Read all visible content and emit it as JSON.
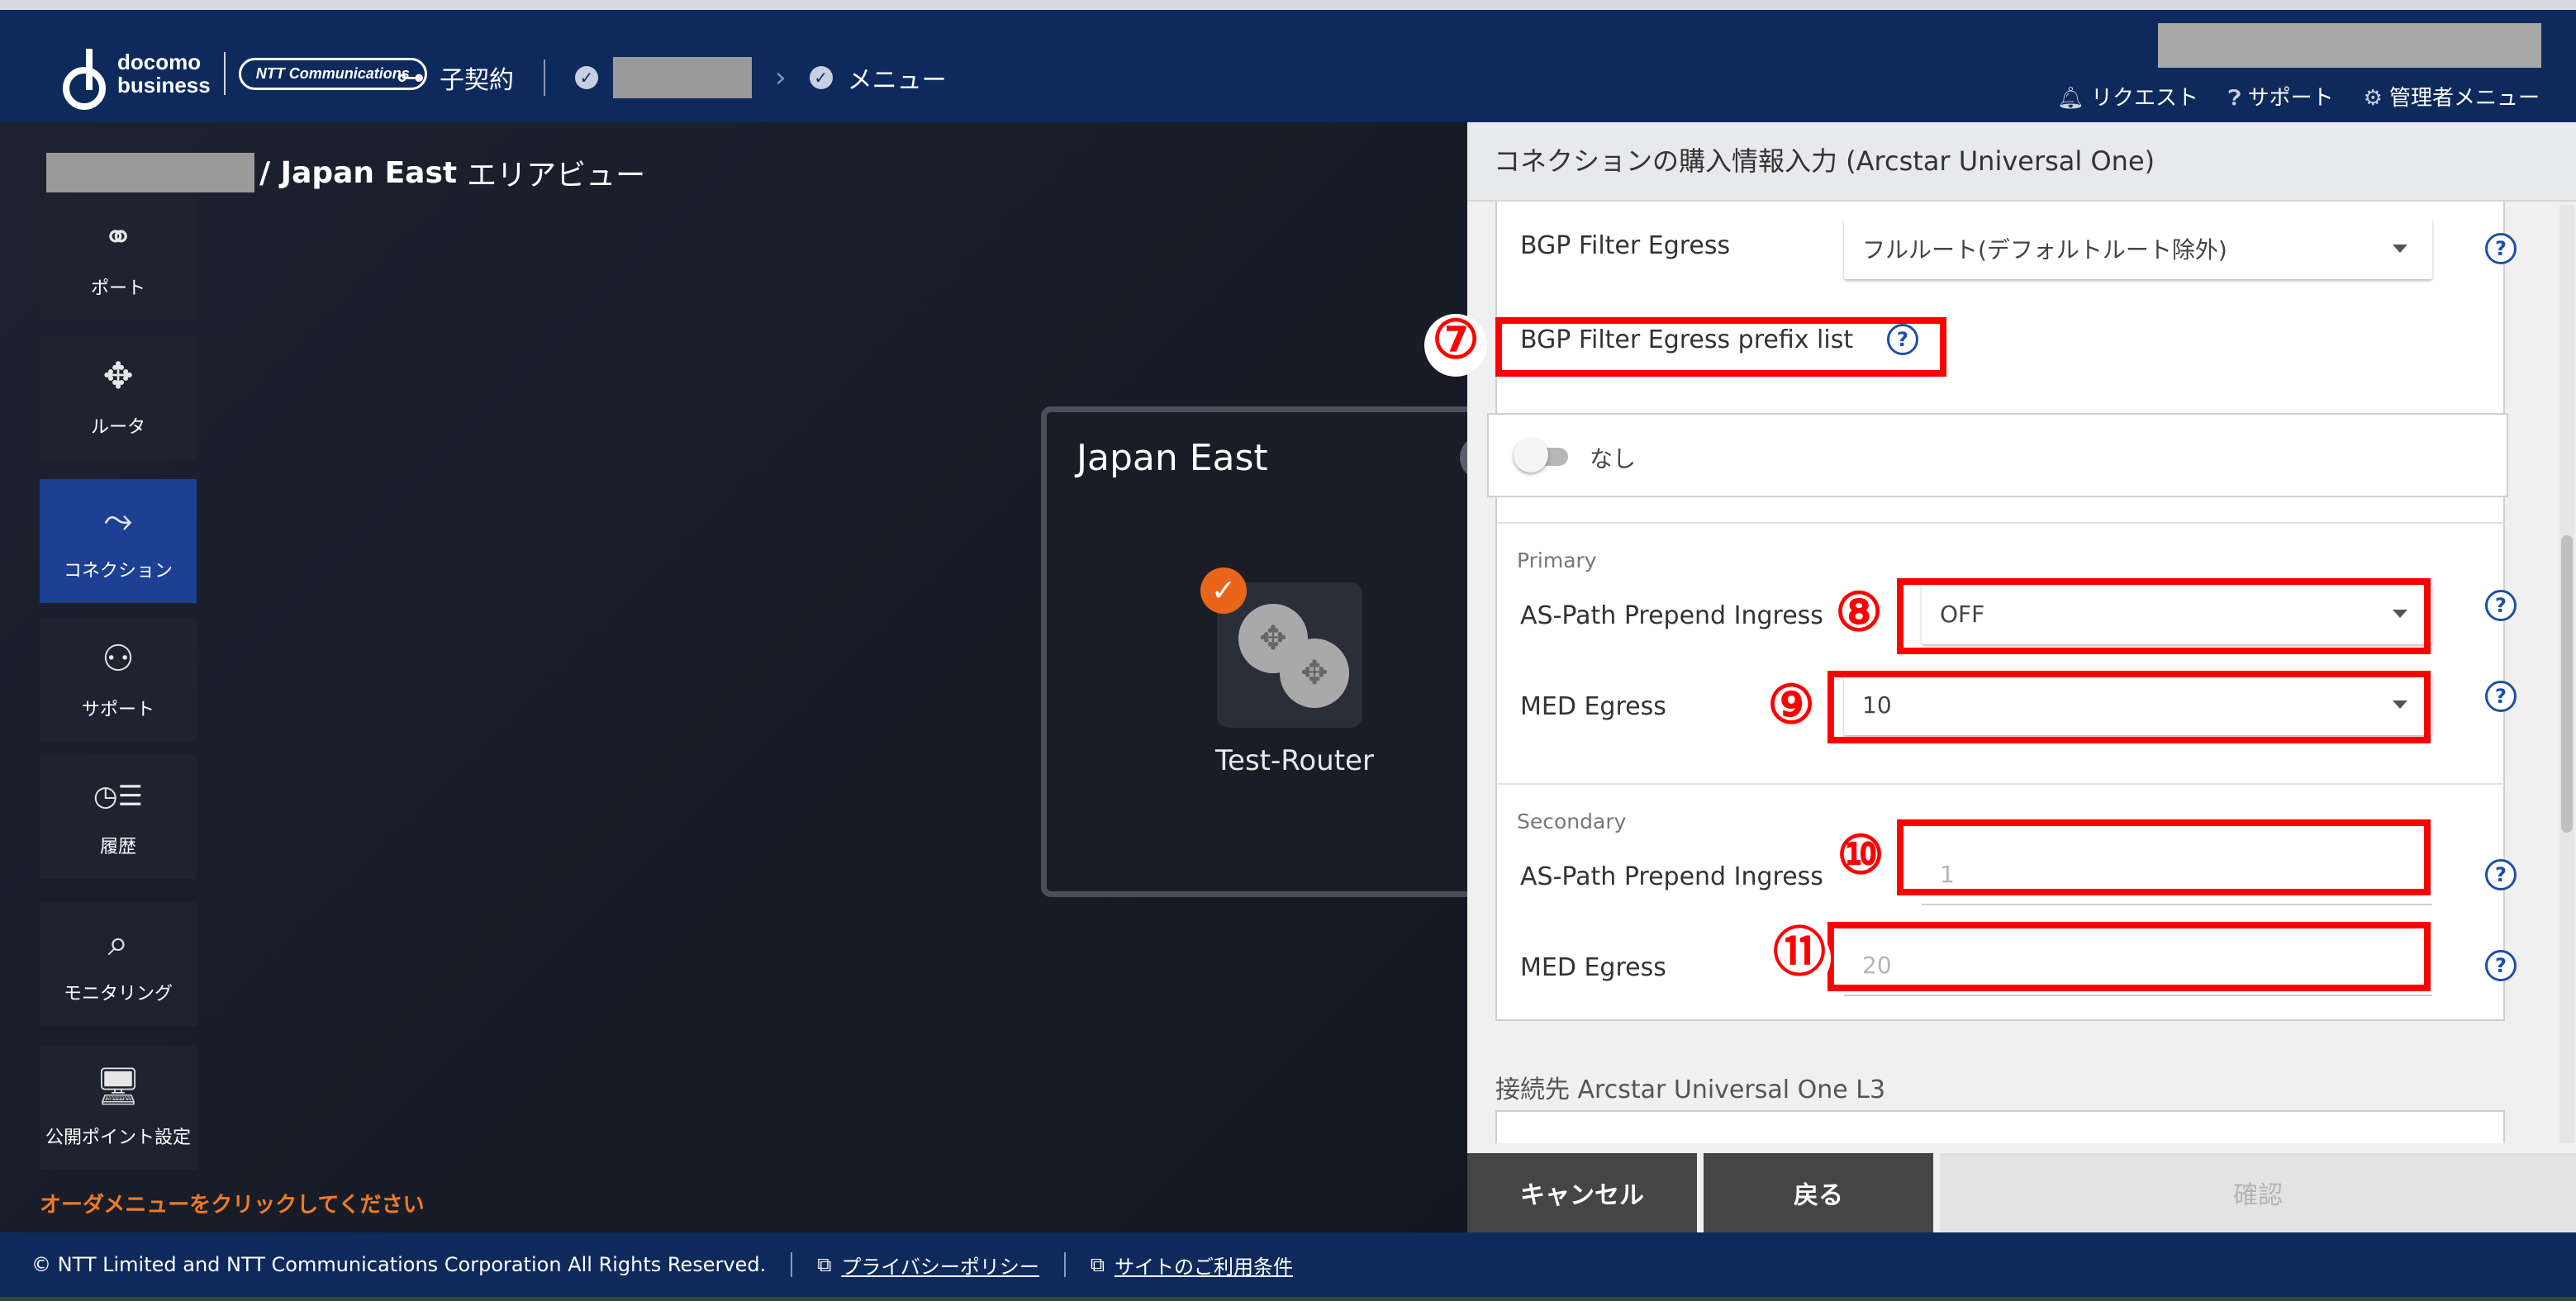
{
  "header": {
    "logo_line1": "docomo",
    "logo_line2": "business",
    "ntt_logo": "NTT Communications",
    "nav_contract": "子契約",
    "nav_menu": "メニュー",
    "menu_request": "リクエスト",
    "menu_support": "サポート",
    "menu_admin": "管理者メニュー"
  },
  "area": {
    "title_suffix": "/ Japan East",
    "title_view": "エリアビュー",
    "box_title": "Japan East",
    "router_label": "Test-Router"
  },
  "sidebar": {
    "items": [
      {
        "label": "ポート",
        "icon": "port-icon"
      },
      {
        "label": "ルータ",
        "icon": "router-icon"
      },
      {
        "label": "コネクション",
        "icon": "connection-icon"
      },
      {
        "label": "サポート",
        "icon": "support-user-icon"
      },
      {
        "label": "履歴",
        "icon": "history-icon"
      },
      {
        "label": "モニタリング",
        "icon": "monitoring-icon"
      },
      {
        "label": "公開ポイント設定",
        "icon": "public-point-icon"
      }
    ],
    "active": "コネクション"
  },
  "order_message": "オーダメニューをクリックしてください",
  "panel": {
    "title": "コネクションの購入情報入力 (Arcstar Universal One)",
    "bgp_filter_egress_label": "BGP Filter Egress",
    "bgp_filter_egress_value": "フルルート(デフォルトルート除外)",
    "bgp_prefix_label": "BGP Filter Egress prefix list",
    "toggle_label": "なし",
    "primary_label": "Primary",
    "primary_aspath_label": "AS-Path Prepend Ingress",
    "primary_aspath_value": "OFF",
    "primary_med_label": "MED Egress",
    "primary_med_value": "10",
    "secondary_label": "Secondary",
    "secondary_aspath_label": "AS-Path Prepend Ingress",
    "secondary_aspath_value": "1",
    "secondary_med_label": "MED Egress",
    "secondary_med_value": "20",
    "connection_target_label": "接続先 Arcstar Universal One L3",
    "help_glyph": "?"
  },
  "annotations": {
    "n7": "⑦",
    "n8": "⑧",
    "n9": "⑨",
    "n10": "⑩",
    "n11": "⑪",
    "color": "#ff0000"
  },
  "buttons": {
    "cancel": "キャンセル",
    "back": "戻る",
    "confirm": "確認"
  },
  "footer": {
    "copyright": "© NTT Limited and NTT Communications Corporation All Rights Reserved.",
    "privacy": "プライバシーポリシー",
    "terms": "サイトのご利用条件"
  },
  "colors": {
    "header": "#0e2a5c",
    "active_nav": "#1d3f94",
    "accent_orange": "#f07b22",
    "help_blue": "#1d4ea8"
  }
}
